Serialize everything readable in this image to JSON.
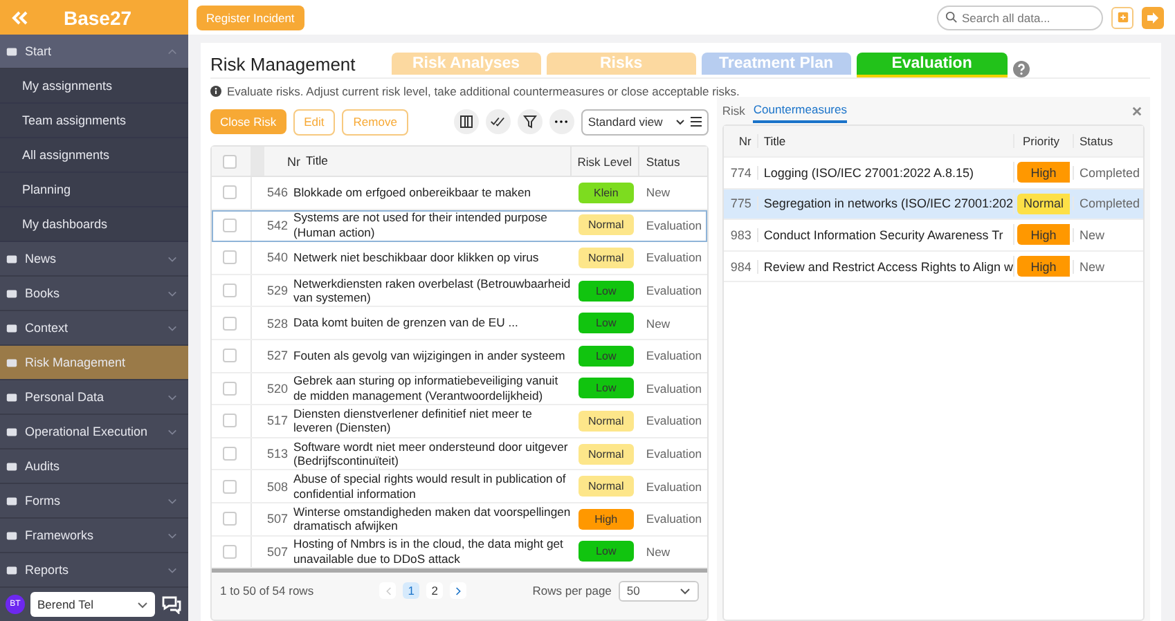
{
  "brand": {
    "name": "Base27"
  },
  "sidebar": {
    "items": [
      {
        "label": "Start",
        "kind": "group",
        "expanded": true,
        "selected": false,
        "children": [
          {
            "label": "My assignments"
          },
          {
            "label": "Team assignments"
          },
          {
            "label": "All assignments"
          },
          {
            "label": "Planning"
          },
          {
            "label": "My dashboards"
          }
        ]
      },
      {
        "label": "News",
        "kind": "group",
        "expanded": false,
        "selected": false
      },
      {
        "label": "Books",
        "kind": "group",
        "expanded": false,
        "selected": false
      },
      {
        "label": "Context",
        "kind": "group",
        "expanded": false,
        "selected": false
      },
      {
        "label": "Risk Management",
        "kind": "link",
        "expanded": false,
        "selected": true
      },
      {
        "label": "Personal Data",
        "kind": "group",
        "expanded": false,
        "selected": false
      },
      {
        "label": "Operational Execution",
        "kind": "group",
        "expanded": false,
        "selected": false
      },
      {
        "label": "Audits",
        "kind": "link",
        "expanded": false,
        "selected": false
      },
      {
        "label": "Forms",
        "kind": "group",
        "expanded": false,
        "selected": false
      },
      {
        "label": "Frameworks",
        "kind": "group",
        "expanded": false,
        "selected": false
      },
      {
        "label": "Reports",
        "kind": "group",
        "expanded": false,
        "selected": false
      }
    ],
    "user": {
      "initials": "BT",
      "name": "Berend Tel"
    }
  },
  "topbar": {
    "action": "Register Incident",
    "search": {
      "placeholder": "Search all data..."
    }
  },
  "page": {
    "title": "Risk Management",
    "info": "Evaluate risks. Adjust current risk level, take additional countermeasures or close acceptable risks.",
    "phases": [
      {
        "label": "Risk Analyses",
        "color": "#fcd9a0",
        "selected": false
      },
      {
        "label": "Risks",
        "color": "#fcd9a0",
        "selected": false
      },
      {
        "label": "Treatment Plan",
        "color": "#b7cdf0",
        "selected": false
      },
      {
        "label": "Evaluation",
        "color": "#22c21a",
        "selected": true
      }
    ]
  },
  "toolbar": {
    "buttons": [
      {
        "label": "Close Risk",
        "kind": "primary"
      },
      {
        "label": "Edit",
        "kind": "outline"
      },
      {
        "label": "Remove",
        "kind": "outline"
      }
    ],
    "view": "Standard view"
  },
  "table": {
    "select_all_checked": false,
    "columns": [
      "Nr",
      "Title",
      "Risk Level",
      "Status"
    ],
    "rows": [
      {
        "checked": false,
        "nr": "546",
        "title": "Blokkade om erfgoed onbereikbaar te maken",
        "level": "Klein",
        "color": "#7ddc1f",
        "status": "New",
        "selected": false
      },
      {
        "checked": false,
        "nr": "542",
        "title": "Systems are not used for their intended purpose (Human action)",
        "level": "Normal",
        "color": "#fde68a",
        "status": "Evaluation",
        "selected": true
      },
      {
        "checked": false,
        "nr": "540",
        "title": "Netwerk niet beschikbaar door klikken op virus",
        "level": "Normal",
        "color": "#fde68a",
        "status": "Evaluation",
        "selected": false
      },
      {
        "checked": false,
        "nr": "529",
        "title": "Netwerkdiensten raken overbelast (Betrouwbaarheid van systemen)",
        "level": "Low",
        "color": "#11c40f",
        "status": "Evaluation",
        "selected": false
      },
      {
        "checked": false,
        "nr": "528",
        "title": "Data komt buiten de grenzen van de EU ...",
        "level": "Low",
        "color": "#11c40f",
        "status": "New",
        "selected": false
      },
      {
        "checked": false,
        "nr": "527",
        "title": "Fouten als gevolg van wijzigingen in ander systeem",
        "level": "Low",
        "color": "#11c40f",
        "status": "Evaluation",
        "selected": false
      },
      {
        "checked": false,
        "nr": "520",
        "title": "Gebrek aan sturing op informatiebeveiliging vanuit de midden management (Verantwoordelijkheid)",
        "level": "Low",
        "color": "#11c40f",
        "status": "Evaluation",
        "selected": false
      },
      {
        "checked": false,
        "nr": "517",
        "title": "Diensten dienstverlener definitief niet meer te leveren (Diensten)",
        "level": "Normal",
        "color": "#fde68a",
        "status": "Evaluation",
        "selected": false
      },
      {
        "checked": false,
        "nr": "513",
        "title": "Software wordt niet meer ondersteund door uitgever (Bedrijfscontinuïteit)",
        "level": "Normal",
        "color": "#fde68a",
        "status": "Evaluation",
        "selected": false
      },
      {
        "checked": false,
        "nr": "508",
        "title": "Abuse of special rights would result in publication of confidential information",
        "level": "Normal",
        "color": "#fde68a",
        "status": "Evaluation",
        "selected": false
      },
      {
        "checked": false,
        "nr": "507",
        "title": "Winterse omstandigheden maken dat voorspellingen dramatisch afwijken",
        "level": "High",
        "color": "#ff9800",
        "status": "Evaluation",
        "selected": false
      },
      {
        "checked": false,
        "nr": "507",
        "title": "Hosting of Nmbrs is in the cloud, the data might get unavailable due to DDoS attack",
        "level": "Low",
        "color": "#11c40f",
        "status": "New",
        "selected": false
      }
    ],
    "footer": {
      "summary": "1 to 50 of 54 rows",
      "pages": [
        {
          "label": "1",
          "selected": true
        },
        {
          "label": "2",
          "selected": false
        }
      ],
      "rows_label": "Rows per page",
      "rows_value": "50"
    }
  },
  "panel": {
    "tabs": [
      {
        "label": "Risk",
        "selected": false
      },
      {
        "label": "Countermeasures",
        "selected": true
      }
    ],
    "columns": [
      "Nr",
      "Title",
      "Priority",
      "Status"
    ],
    "rows": [
      {
        "nr": "774",
        "title": "Logging (ISO/IEC 27001:2022 A.8.15)",
        "priority": "High",
        "color": "#ff9800",
        "status": "Completed",
        "selected": false
      },
      {
        "nr": "775",
        "title": "Segregation in networks (ISO/IEC 27001:202",
        "priority": "Normal",
        "color": "#fde047",
        "status": "Completed",
        "selected": true
      },
      {
        "nr": "983",
        "title": "Conduct Information Security Awareness Tr",
        "priority": "High",
        "color": "#ff9800",
        "status": "New",
        "selected": false
      },
      {
        "nr": "984",
        "title": "Review and Restrict Access Rights to Align w",
        "priority": "High",
        "color": "#ff9800",
        "status": "New",
        "selected": false
      }
    ]
  }
}
